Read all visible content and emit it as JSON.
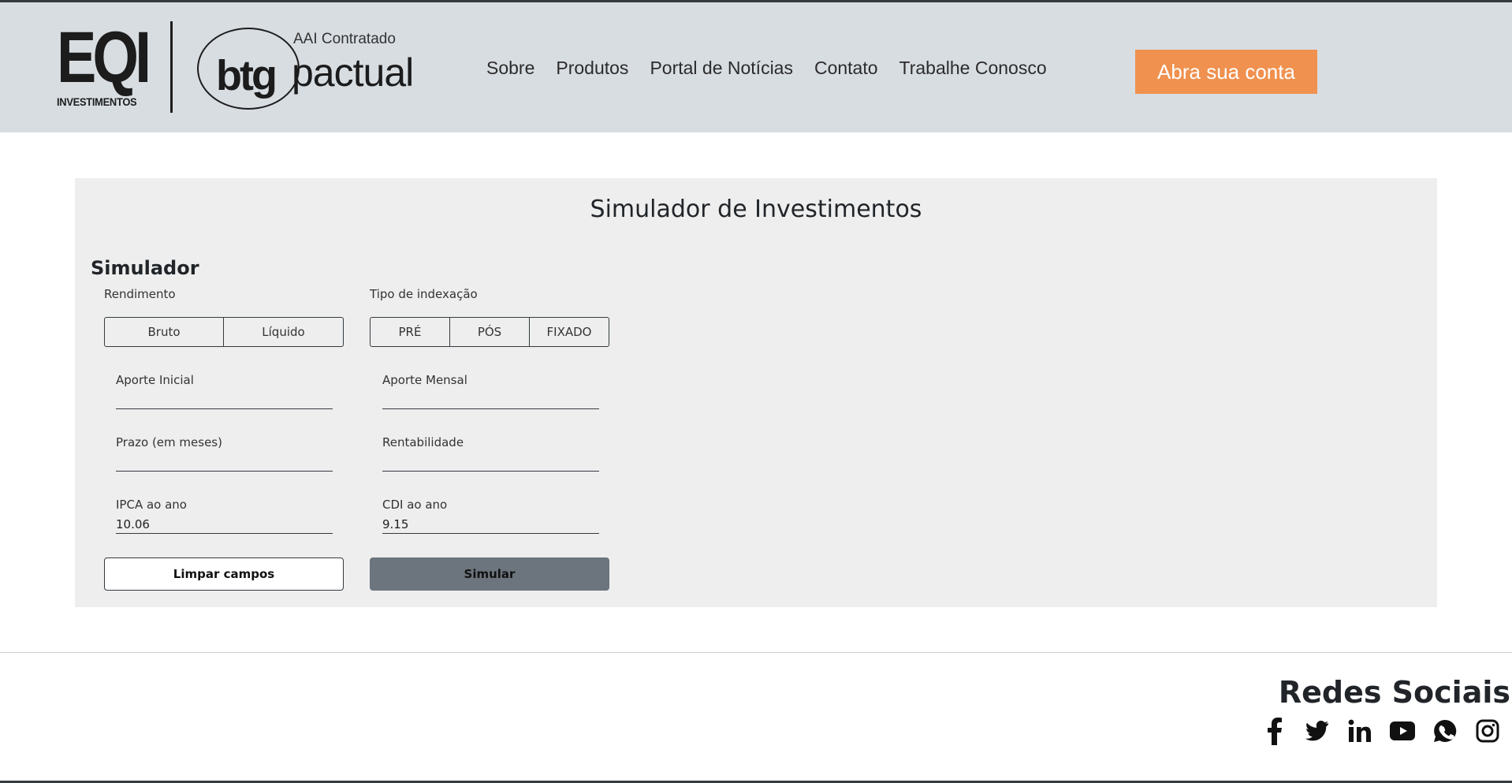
{
  "header": {
    "logo_eqi": {
      "mark": "EQI",
      "sub": "INVESTIMENTOS"
    },
    "logo_btg": {
      "contract": "AAI Contratado",
      "btg": "btg",
      "pactual": "pactual"
    },
    "nav": [
      "Sobre",
      "Produtos",
      "Portal de Notícias",
      "Contato",
      "Trabalhe Conosco"
    ],
    "cta_label": "Abra sua conta",
    "cta_color": "#f0914f"
  },
  "main": {
    "title": "Simulador de Investimentos",
    "section_title": "Simulador",
    "rendimento": {
      "label": "Rendimento",
      "options": [
        "Bruto",
        "Líquido"
      ]
    },
    "indexacao": {
      "label": "Tipo de indexação",
      "options": [
        "PRÉ",
        "PÓS",
        "FIXADO"
      ]
    },
    "fields": {
      "aporte_inicial": {
        "label": "Aporte Inicial",
        "value": ""
      },
      "aporte_mensal": {
        "label": "Aporte Mensal",
        "value": ""
      },
      "prazo": {
        "label": "Prazo (em meses)",
        "value": ""
      },
      "rentabilidade": {
        "label": "Rentabilidade",
        "value": ""
      },
      "ipca": {
        "label": "IPCA ao ano",
        "value": "10.06"
      },
      "cdi": {
        "label": "CDI ao ano",
        "value": "9.15"
      }
    },
    "clear_label": "Limpar campos",
    "simulate_label": "Simular",
    "simulate_color": "#6c757d"
  },
  "footer": {
    "social_title": "Redes Sociais",
    "icons": [
      "facebook-icon",
      "twitter-icon",
      "linkedin-icon",
      "youtube-icon",
      "whatsapp-icon",
      "instagram-icon"
    ]
  }
}
